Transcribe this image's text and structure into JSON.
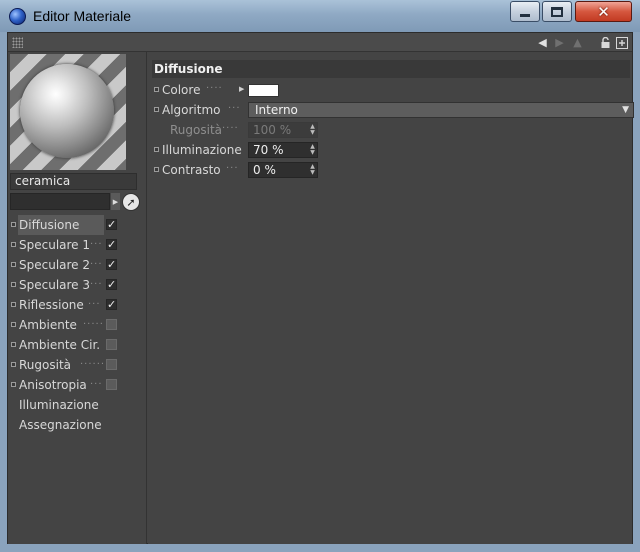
{
  "window": {
    "title": "Editor Materiale"
  },
  "material": {
    "name": "ceramica"
  },
  "channels": [
    {
      "label": "Diffusione",
      "checked": true,
      "selected": true
    },
    {
      "label": "Speculare 1",
      "checked": true
    },
    {
      "label": "Speculare 2",
      "checked": true
    },
    {
      "label": "Speculare 3",
      "checked": true
    },
    {
      "label": "Riflessione",
      "checked": true
    },
    {
      "label": "Ambiente",
      "checked": false
    },
    {
      "label": "Ambiente Cir.",
      "checked": false
    },
    {
      "label": "Rugosità",
      "checked": false
    },
    {
      "label": "Anisotropia",
      "checked": false
    },
    {
      "label": "Illuminazione"
    },
    {
      "label": "Assegnazione"
    }
  ],
  "section": {
    "title": "Diffusione",
    "colore": {
      "label": "Colore",
      "swatch": "#ffffff"
    },
    "algoritmo": {
      "label": "Algoritmo",
      "value": "Interno"
    },
    "rugosita": {
      "label": "Rugosità",
      "value": "100 %"
    },
    "illuminazione": {
      "label": "Illuminazione",
      "value": "70 %"
    },
    "contrasto": {
      "label": "Contrasto",
      "value": "0 %"
    }
  },
  "icons": {
    "window": "material-sphere-icon",
    "back": "arrow-left-icon",
    "forward": "arrow-right-icon",
    "up": "arrow-up-icon",
    "lock": "lock-icon",
    "new": "new-window-icon",
    "pick": "pick-cursor-icon"
  }
}
